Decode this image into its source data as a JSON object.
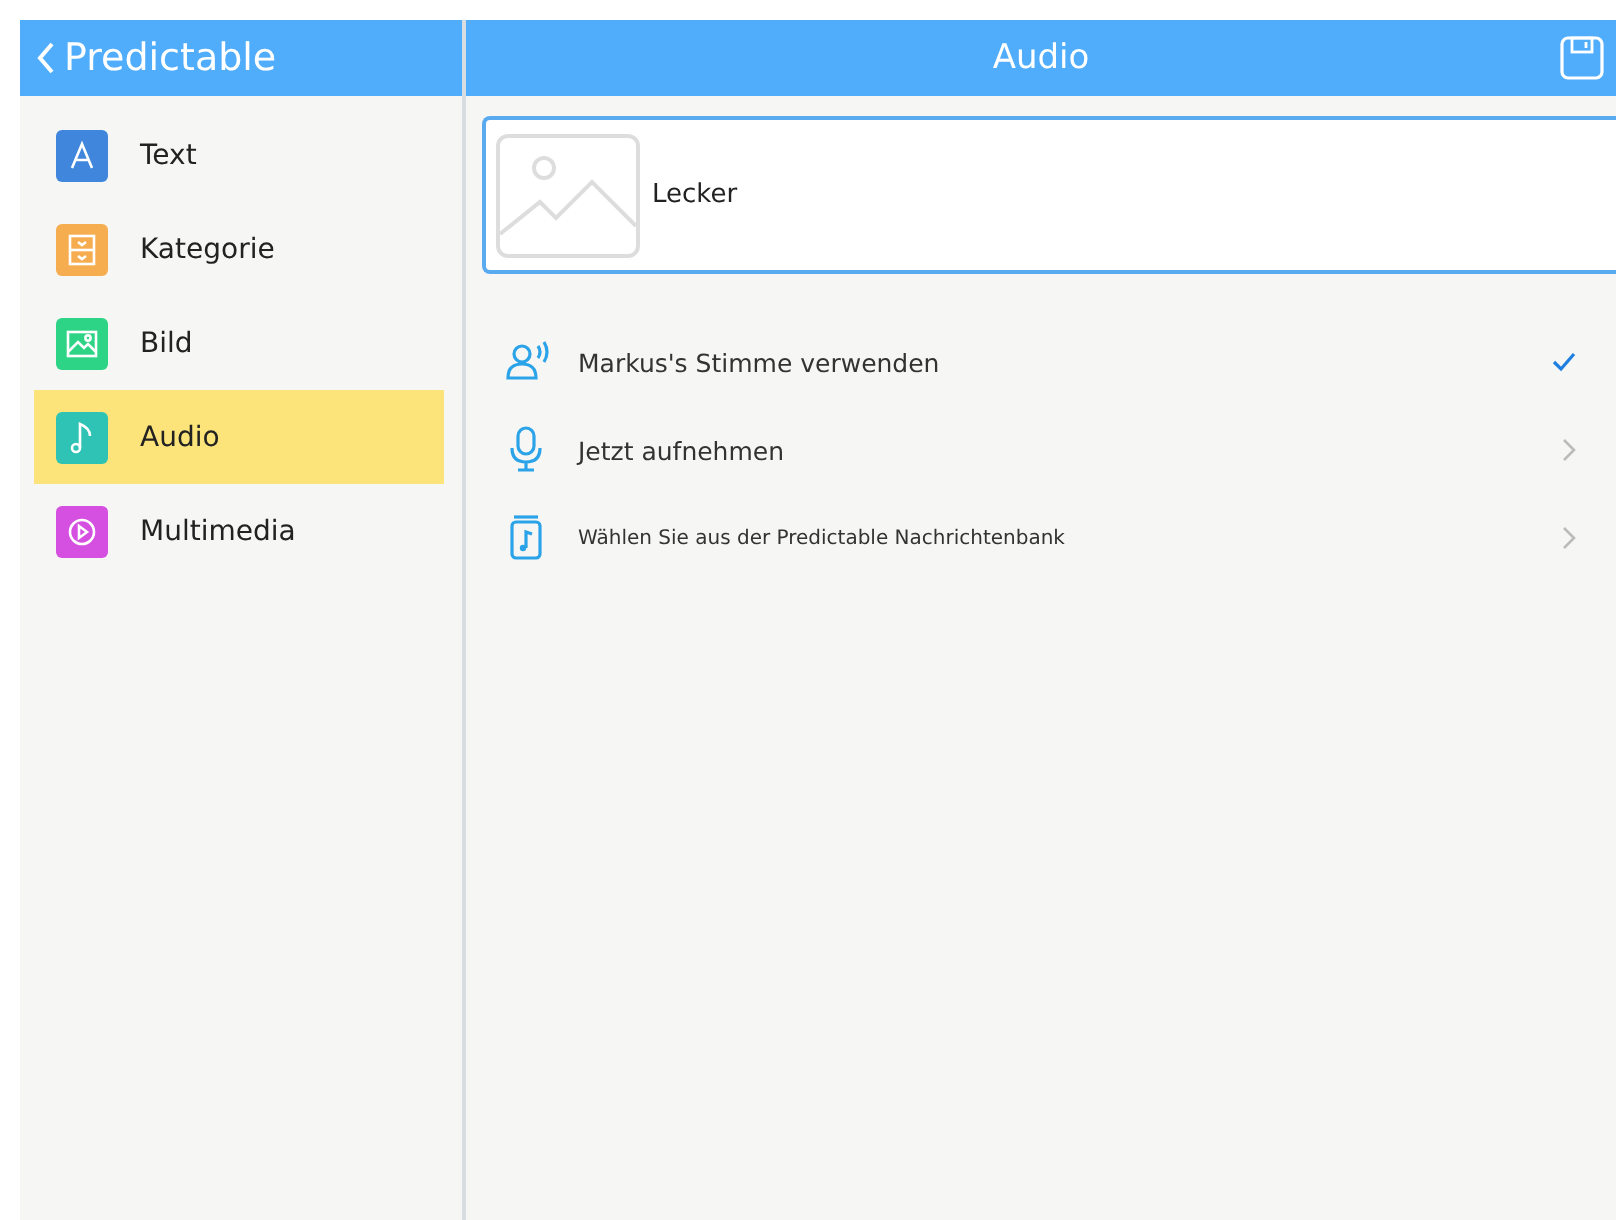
{
  "back_button": {
    "label": "Predictable"
  },
  "header": {
    "title": "Audio"
  },
  "sidebar": {
    "items": [
      {
        "label": "Text",
        "kind": "text",
        "color": "#3f86dc",
        "selected": false
      },
      {
        "label": "Kategorie",
        "kind": "category",
        "color": "#f6ad4f",
        "selected": false
      },
      {
        "label": "Bild",
        "kind": "image",
        "color": "#2ed486",
        "selected": false
      },
      {
        "label": "Audio",
        "kind": "audio",
        "color": "#2ec3b4",
        "selected": true
      },
      {
        "label": "Multimedia",
        "kind": "video",
        "color": "#d54fe0",
        "selected": false
      }
    ]
  },
  "message": {
    "label": "Lecker"
  },
  "options": [
    {
      "label": "Markus's Stimme verwenden",
      "kind": "voice",
      "checked": true
    },
    {
      "label": "Jetzt aufnehmen",
      "kind": "mic",
      "checked": false
    },
    {
      "label": "Wählen Sie aus der Predictable Nachrichtenbank",
      "kind": "bank",
      "checked": false
    }
  ]
}
